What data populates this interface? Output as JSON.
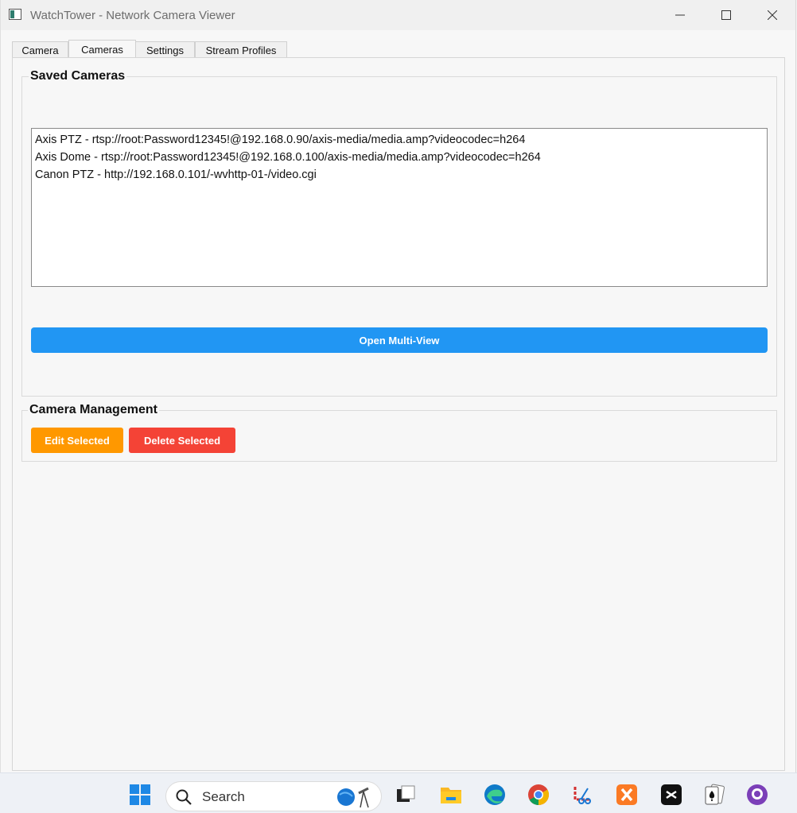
{
  "window": {
    "title": "WatchTower - Network Camera Viewer"
  },
  "tabs": [
    {
      "label": "Camera",
      "active": false
    },
    {
      "label": "Cameras",
      "active": true
    },
    {
      "label": "Settings",
      "active": false
    },
    {
      "label": "Stream Profiles",
      "active": false
    }
  ],
  "saved_cameras": {
    "title": "Saved Cameras",
    "items": [
      "Axis PTZ - rtsp://root:Password12345!@192.168.0.90/axis-media/media.amp?videocodec=h264",
      "Axis Dome - rtsp://root:Password12345!@192.168.0.100/axis-media/media.amp?videocodec=h264",
      "Canon PTZ - http://192.168.0.101/-wvhttp-01-/video.cgi"
    ],
    "multi_view_label": "Open Multi-View"
  },
  "camera_management": {
    "title": "Camera Management",
    "edit_label": "Edit Selected",
    "delete_label": "Delete Selected"
  },
  "taskbar": {
    "search_label": "Search",
    "icons": [
      "windows-start-icon",
      "search-icon",
      "task-view-icon",
      "file-explorer-icon",
      "edge-icon",
      "chrome-icon",
      "snipping-tool-icon",
      "xampp-icon",
      "capcut-icon",
      "solitaire-icon",
      "github-icon"
    ]
  },
  "colors": {
    "multi_view": "#2196f3",
    "edit": "#ff9800",
    "delete": "#f44336"
  }
}
